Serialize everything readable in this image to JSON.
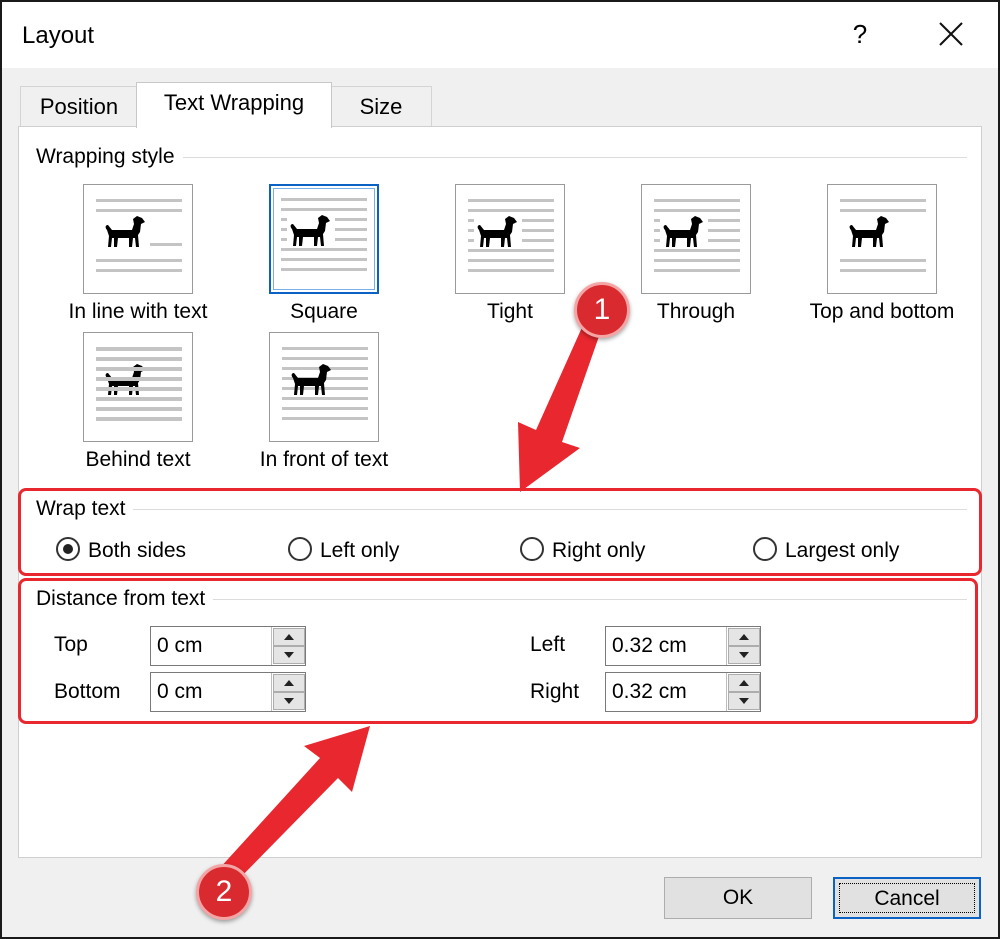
{
  "dialog": {
    "title": "Layout",
    "help_label": "?"
  },
  "tabs": [
    {
      "label": "Position",
      "active": false
    },
    {
      "label": "Text Wrapping",
      "active": true
    },
    {
      "label": "Size",
      "active": false
    }
  ],
  "wrapping_style": {
    "heading": "Wrapping style",
    "options": [
      {
        "label": "In line with text",
        "icon": "inline-wrap-icon",
        "selected": false
      },
      {
        "label": "Square",
        "icon": "square-wrap-icon",
        "selected": true
      },
      {
        "label": "Tight",
        "icon": "tight-wrap-icon",
        "selected": false
      },
      {
        "label": "Through",
        "icon": "through-wrap-icon",
        "selected": false
      },
      {
        "label": "Top and bottom",
        "icon": "top-bottom-wrap-icon",
        "selected": false
      },
      {
        "label": "Behind text",
        "icon": "behind-text-icon",
        "selected": false
      },
      {
        "label": "In front of text",
        "icon": "in-front-text-icon",
        "selected": false
      }
    ]
  },
  "wrap_text": {
    "heading": "Wrap text",
    "options": [
      {
        "label": "Both sides",
        "checked": true
      },
      {
        "label": "Left only",
        "checked": false
      },
      {
        "label": "Right only",
        "checked": false
      },
      {
        "label": "Largest only",
        "checked": false
      }
    ]
  },
  "distance": {
    "heading": "Distance from text",
    "top": {
      "label": "Top",
      "value": "0 cm"
    },
    "bottom": {
      "label": "Bottom",
      "value": "0 cm"
    },
    "left": {
      "label": "Left",
      "value": "0.32 cm"
    },
    "right": {
      "label": "Right",
      "value": "0.32 cm"
    }
  },
  "buttons": {
    "ok": "OK",
    "cancel": "Cancel"
  },
  "annotations": {
    "marker_1": "1",
    "marker_2": "2",
    "color": "#e8272f"
  }
}
